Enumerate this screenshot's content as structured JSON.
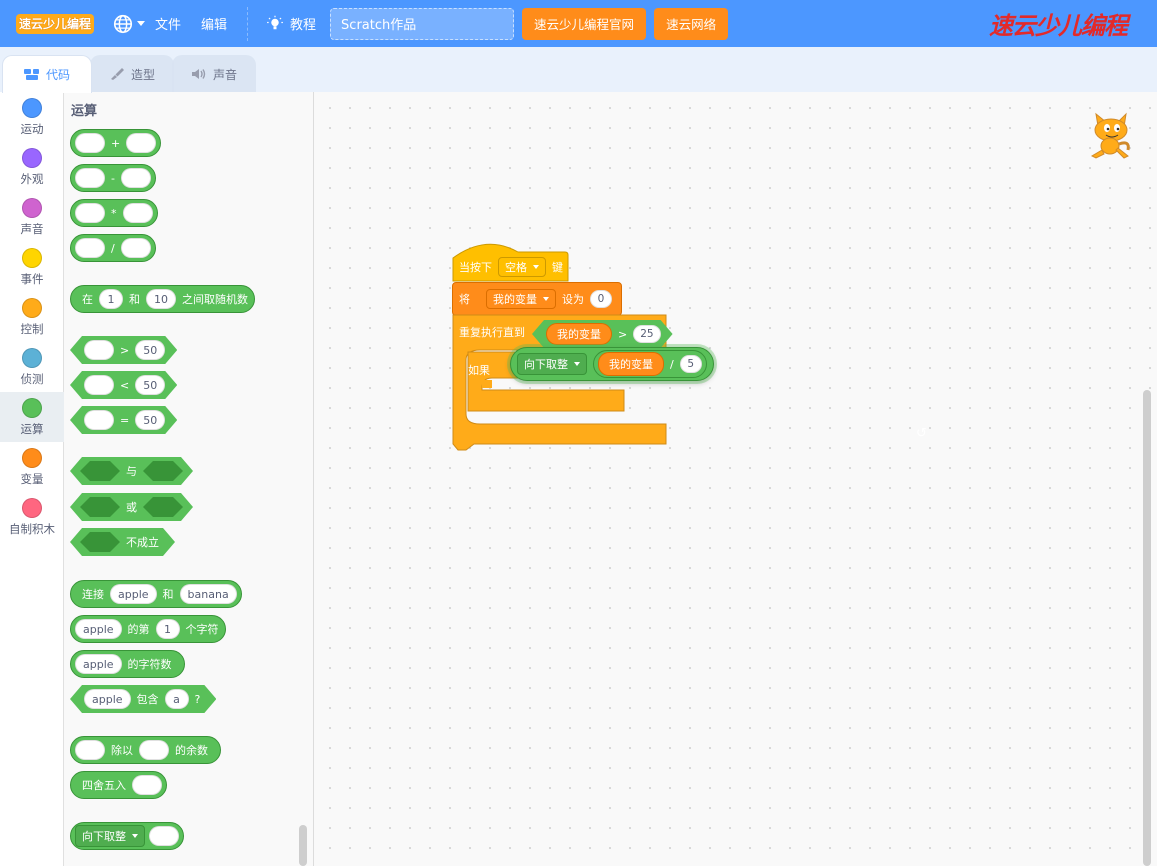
{
  "menubar": {
    "logo": "速云少儿编程",
    "file": "文件",
    "edit": "编辑",
    "tutorials": "教程",
    "project_title": "Scratch作品",
    "btn_official": "速云少儿编程官网",
    "btn_network": "速云网络",
    "brand": "速云少儿编程"
  },
  "tabs": {
    "code": "代码",
    "costumes": "造型",
    "sounds": "声音"
  },
  "categories": [
    {
      "label": "运动",
      "color": "#4c97ff"
    },
    {
      "label": "外观",
      "color": "#9966ff"
    },
    {
      "label": "声音",
      "color": "#cf63cf"
    },
    {
      "label": "事件",
      "color": "#ffd500"
    },
    {
      "label": "控制",
      "color": "#ffab19"
    },
    {
      "label": "侦测",
      "color": "#5cb1d6"
    },
    {
      "label": "运算",
      "color": "#59c059"
    },
    {
      "label": "变量",
      "color": "#ff8c1a"
    },
    {
      "label": "自制积木",
      "color": "#ff6680"
    }
  ],
  "palette": {
    "title": "运算",
    "add": "+",
    "sub": "-",
    "mul": "*",
    "div": "/",
    "random_pre": "在",
    "random_a": "1",
    "random_and": "和",
    "random_b": "10",
    "random_post": "之间取随机数",
    "gt": ">",
    "lt": "<",
    "eq": "=",
    "cmp_val": "50",
    "and": "与",
    "or": "或",
    "not": "不成立",
    "join": "连接",
    "apple": "apple",
    "banana": "banana",
    "letter_of_a": "的第",
    "letter_one": "1",
    "letter_of_b": "个字符",
    "length_of": "的字符数",
    "contains": "包含",
    "contains_a": "a",
    "question": "?",
    "mod_a": "除以",
    "mod_b": "的余数",
    "round": "四舍五入",
    "floor": "向下取整"
  },
  "script": {
    "when_key": "当按下",
    "key": "空格",
    "key_suffix": "键",
    "set": "将",
    "var": "我的变量",
    "set_to": "设为",
    "set_val": "0",
    "repeat_until": "重复执行直到",
    "gt": ">",
    "gt_val": "25",
    "if": "如果",
    "floor": "向下取整",
    "div": "/",
    "div_val": "5"
  },
  "colors": {
    "menubar": "#4c97ff",
    "operators": "#59c059",
    "events": "#ffbf00",
    "control": "#ffab19",
    "variables": "#ff8c1a"
  }
}
